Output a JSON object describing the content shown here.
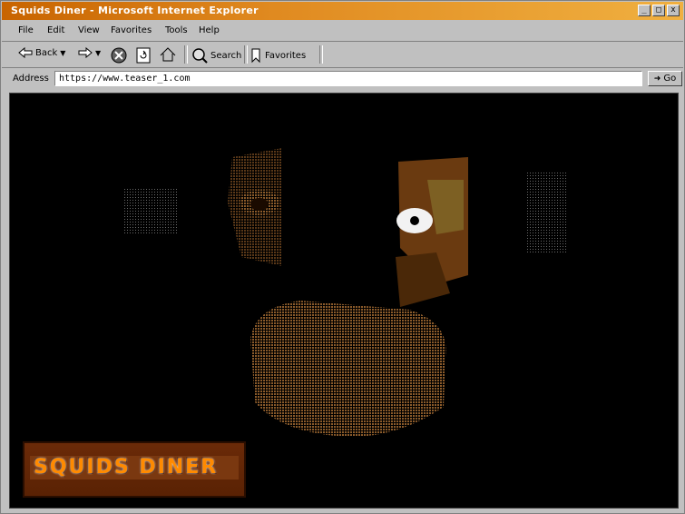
{
  "window": {
    "title": "Squids Diner - Microsoft Internet Explorer",
    "buttons": {
      "minimize": "_",
      "maximize": "□",
      "close": "x"
    }
  },
  "menubar": {
    "items": [
      "File",
      "Edit",
      "View",
      "Favorites",
      "Tools",
      "Help"
    ]
  },
  "toolbar": {
    "back_label": "Back",
    "search_label": "Search",
    "favorites_label": "Favorites"
  },
  "address": {
    "label": "Address",
    "url": "https://www.teaser_1.com",
    "go_label": "Go"
  },
  "page": {
    "logo_text": "SQUIDS DINER"
  },
  "colors": {
    "title_bar": "#e08a20",
    "chrome": "#c0c0c0",
    "page_background": "#000000",
    "logo_orange": "#ff8a00"
  }
}
